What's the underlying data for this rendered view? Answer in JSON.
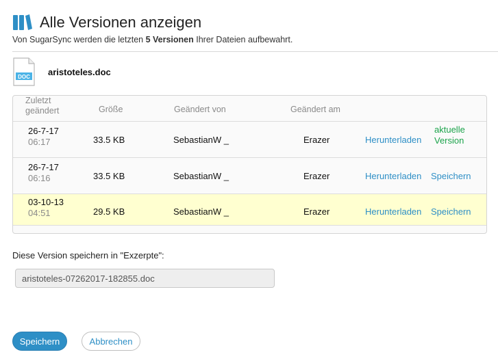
{
  "dialog": {
    "title": "Alle Versionen anzeigen",
    "subtitle_prefix": "Von SugarSync werden die letzten ",
    "subtitle_bold": "5 Versionen",
    "subtitle_suffix": " Ihrer Dateien aufbewahrt.",
    "icon": "book-icon",
    "accent_color": "#2e8fc6"
  },
  "file": {
    "name": "aristoteles.doc",
    "icon": "doc-file-icon",
    "icon_label": "DOC"
  },
  "table": {
    "headers": {
      "date_line1": "Zuletzt",
      "date_line2": "geändert",
      "size": "Größe",
      "changed_by": "Geändert von",
      "changed_on": "Geändert am"
    },
    "rows": [
      {
        "date": "26-7-17",
        "time": "06:17",
        "size": "33.5 KB",
        "changed_by": "SebastianW _",
        "changed_on": "Erazer",
        "download": "Herunterladen",
        "status_line1": "aktuelle",
        "status_line2": "Version",
        "highlighted": false
      },
      {
        "date": "26-7-17",
        "time": "06:16",
        "size": "33.5 KB",
        "changed_by": "SebastianW _",
        "changed_on": "Erazer",
        "download": "Herunterladen",
        "save": "Speichern",
        "highlighted": false
      },
      {
        "date": "03-10-13",
        "time": "04:51",
        "size": "29.5 KB",
        "changed_by": "SebastianW _",
        "changed_on": "Erazer",
        "download": "Herunterladen",
        "save": "Speichern",
        "highlighted": true
      }
    ]
  },
  "save_section": {
    "label": "Diese Version speichern in \"Exzerpte\":",
    "filename_value": "aristoteles-07262017-182855.doc"
  },
  "buttons": {
    "save": "Speichern",
    "cancel": "Abbrechen"
  },
  "colors": {
    "link": "#2e8fc6",
    "current_version": "#1aa34a",
    "highlight_row": "#ffffd0"
  }
}
